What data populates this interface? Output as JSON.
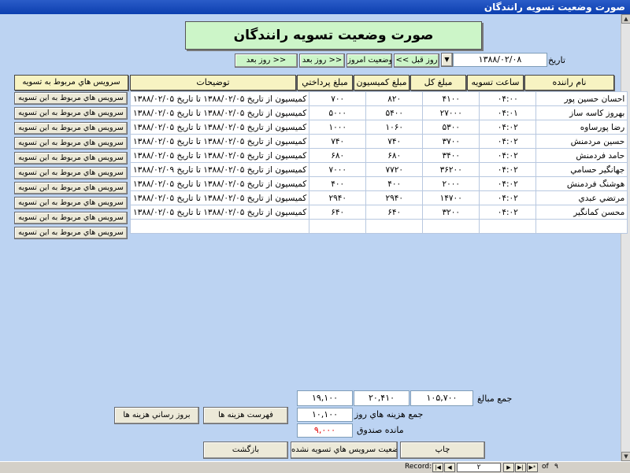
{
  "window": {
    "title": "صورت وضعيت تسويه رانندگان"
  },
  "header": {
    "title": "صورت وضعيت تسويه رانندگان"
  },
  "date": {
    "label": "تاريخ",
    "value": "۱۳۸۸/۰۲/۰۸"
  },
  "nav": {
    "prev_day": "<< روز قبل",
    "today": "صورت وضعيت امروز",
    "next_day": "روز بعد >>"
  },
  "columns": {
    "driver": "نام راننده",
    "time": "ساعت تسويه",
    "total": "مبلغ كل",
    "commission": "مبلغ كميسيون",
    "paid": "مبلغ پرداختي",
    "desc": "توضيحات",
    "services": "سرويس هاي مربوط به تسويه"
  },
  "row_button_label": "سرويس هاي مربوط به اين تسويه",
  "rows": [
    {
      "driver": "احسان حسين پور",
      "time": "۰۴:۰۰",
      "total": "۴۱۰۰",
      "commission": "۸۲۰",
      "paid": "۷۰۰",
      "desc": "كميسيون از تاريخ ۱۳۸۸/۰۲/۰۵ تا تاريخ ۱۳۸۸/۰۲/۰۵"
    },
    {
      "driver": "بهروز كاسه ساز",
      "time": "۰۴:۰۱",
      "total": "۲۷۰۰۰",
      "commission": "۵۴۰۰",
      "paid": "۵۰۰۰",
      "desc": "كميسيون از تاريخ ۱۳۸۸/۰۲/۰۵ تا تاريخ ۱۳۸۸/۰۲/۰۵"
    },
    {
      "driver": "رضا پورساوه",
      "time": "۰۴:۰۲",
      "total": "۵۳۰۰",
      "commission": "۱۰۶۰",
      "paid": "۱۰۰۰",
      "desc": "كميسيون از تاريخ ۱۳۸۸/۰۲/۰۵ تا تاريخ ۱۳۸۸/۰۲/۰۵"
    },
    {
      "driver": "حسين مردمنش",
      "time": "۰۴:۰۲",
      "total": "۳۷۰۰",
      "commission": "۷۴۰",
      "paid": "۷۴۰",
      "desc": "كميسيون از تاريخ ۱۳۸۸/۰۲/۰۵ تا تاريخ ۱۳۸۸/۰۲/۰۵"
    },
    {
      "driver": "حامد فردمنش",
      "time": "۰۴:۰۲",
      "total": "۳۴۰۰",
      "commission": "۶۸۰",
      "paid": "۶۸۰",
      "desc": "كميسيون از تاريخ ۱۳۸۸/۰۲/۰۵ تا تاريخ ۱۳۸۸/۰۲/۰۵"
    },
    {
      "driver": "جهانگير حسامي",
      "time": "۰۴:۰۲",
      "total": "۳۶۲۰۰",
      "commission": "۷۷۲۰",
      "paid": "۷۰۰۰",
      "desc": "كميسيون از تاريخ ۱۳۸۸/۰۲/۰۵ تا تاريخ ۱۳۸۸/۰۲/۰۹"
    },
    {
      "driver": "هوشنگ فردمنش",
      "time": "۰۴:۰۲",
      "total": "۲۰۰۰",
      "commission": "۴۰۰",
      "paid": "۴۰۰",
      "desc": "كميسيون از تاريخ ۱۳۸۸/۰۲/۰۵ تا تاريخ ۱۳۸۸/۰۲/۰۵"
    },
    {
      "driver": "مرتضي عبدي",
      "time": "۰۴:۰۲",
      "total": "۱۴۷۰۰",
      "commission": "۲۹۴۰",
      "paid": "۲۹۴۰",
      "desc": "كميسيون از تاريخ ۱۳۸۸/۰۲/۰۵ تا تاريخ ۱۳۸۸/۰۲/۰۵"
    },
    {
      "driver": "محسن كمانگير",
      "time": "۰۴:۰۲",
      "total": "۳۲۰۰",
      "commission": "۶۴۰",
      "paid": "۶۴۰",
      "desc": "كميسيون از تاريخ ۱۳۸۸/۰۲/۰۵ تا تاريخ ۱۳۸۸/۰۲/۰۵"
    }
  ],
  "summary": {
    "total_label": "جمع مبالغ",
    "total_sum": "۱۰۵,۷۰۰",
    "commission_sum": "۲۰,۴۱۰",
    "paid_sum": "۱۹,۱۰۰",
    "expenses_label": "جمع هزينه هاي روز",
    "expenses_value": "۱۰,۱۰۰",
    "balance_label": "مانده صندوق",
    "balance_value": "۹,۰۰۰",
    "balance_color": "#e00000"
  },
  "buttons": {
    "expense_list": "فهرست هزينه ها",
    "update_expenses": "بروز رساني هزينه ها",
    "print": "چاپ",
    "unsettled": "وضعيت سرويس هاي تسويه نشده",
    "back": "بازگشت"
  },
  "record_nav": {
    "label": "Record:",
    "current": "۲",
    "of_label": "of",
    "total": "۹"
  }
}
